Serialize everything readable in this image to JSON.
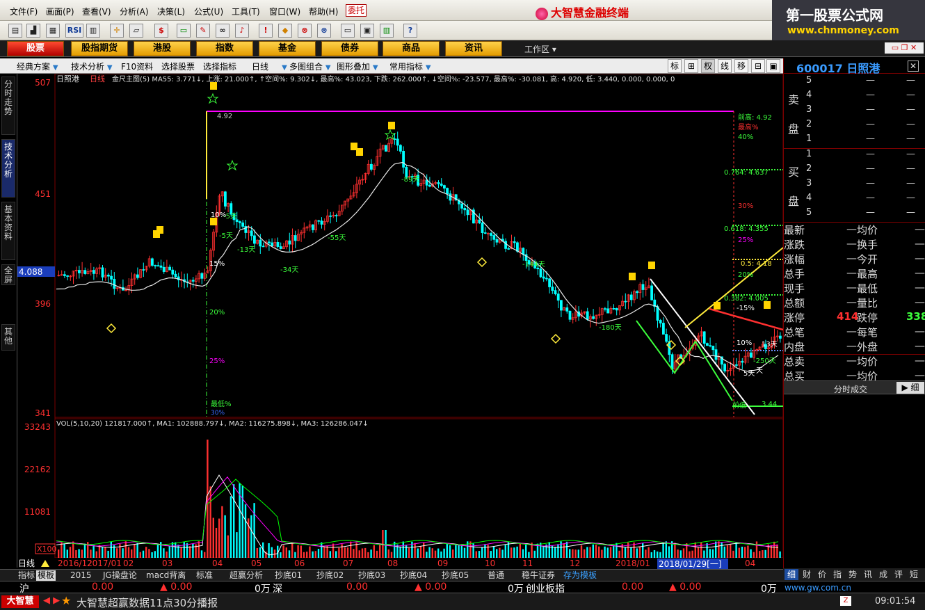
{
  "menu": [
    "文件(F)",
    "画面(P)",
    "查看(V)",
    "分析(A)",
    "决策(L)",
    "公式(U)",
    "工具(T)",
    "窗口(W)",
    "帮助(H)"
  ],
  "menu_entrust": "委托",
  "app_title": "大智慧金融终端",
  "promo": {
    "line1": "第一股票公式网",
    "line2": "www.chnmoney.com"
  },
  "toolbar_icons": [
    "open-icon",
    "chart-icon",
    "grid-icon",
    "rsi-icon",
    "table-icon",
    "crosshair-icon",
    "ruler-icon",
    "dollar-icon",
    "money-icon",
    "pencil-icon",
    "binoculars-icon",
    "bell-icon",
    "news-icon",
    "diamond-icon",
    "link-icon",
    "globe-icon",
    "copy-icon",
    "window-icon",
    "books-icon",
    "help-icon"
  ],
  "toolbar_rsi": "RSI",
  "nav": [
    "股票",
    "股指期货",
    "港股",
    "指数",
    "基金",
    "债券",
    "商品",
    "资讯"
  ],
  "workspace": "工作区",
  "subbar": [
    "经典方案",
    "技术分析",
    "F10资料",
    "选择股票",
    "选择指标",
    "日线",
    "多图组合",
    "图形叠加",
    "常用指标"
  ],
  "subbar_right": [
    "标",
    "⊞",
    "权",
    "线",
    "移",
    "⊟",
    "▣"
  ],
  "left_tabs": [
    "分时走势",
    "技术分析",
    "基本资料",
    "全屏",
    "其他"
  ],
  "stock": {
    "code_name": "600017 日照港"
  },
  "orderbook": {
    "sell_label": [
      "卖",
      "盘"
    ],
    "buy_label": [
      "买",
      "盘"
    ],
    "sell_levels": [
      "5",
      "4",
      "3",
      "2",
      "1"
    ],
    "buy_levels": [
      "1",
      "2",
      "3",
      "4",
      "5"
    ],
    "dash": "—"
  },
  "quote_rows": [
    {
      "k1": "最新",
      "v1": "—",
      "k2": "均价",
      "v2": "—"
    },
    {
      "k1": "涨跌",
      "v1": "—",
      "k2": "换手",
      "v2": "—"
    },
    {
      "k1": "涨幅",
      "v1": "—",
      "k2": "今开",
      "v2": "—"
    },
    {
      "k1": "总手",
      "v1": "—",
      "k2": "最高",
      "v2": "—"
    },
    {
      "k1": "现手",
      "v1": "—",
      "k2": "最低",
      "v2": "—"
    },
    {
      "k1": "总额",
      "v1": "—",
      "k2": "量比",
      "v2": "—"
    },
    {
      "k1": "涨停",
      "v1": "414",
      "k2": "跌停",
      "v2": "338"
    },
    {
      "k1": "总笔",
      "v1": "—",
      "k2": "每笔",
      "v2": "—"
    },
    {
      "k1": "内盘",
      "v1": "—",
      "k2": "外盘",
      "v2": "—"
    },
    {
      "k1": "总卖",
      "v1": "—",
      "k2": "均价",
      "v2": "—"
    },
    {
      "k1": "总买",
      "v1": "—",
      "k2": "均价",
      "v2": "—"
    }
  ],
  "fenshi": {
    "label": "分时成交",
    "fine": "▶ 细"
  },
  "rp_tabs": [
    "细",
    "财",
    "价",
    "指",
    "势",
    "讯",
    "成",
    "评",
    "短"
  ],
  "chart": {
    "header_name": "日照港",
    "header_period": "日线",
    "header_text": "金尺主图(5) MA55: 3.771↓, 上涨: 21.000↑, ↑空间%: 9.302↓, 最高%: 43.023, 下跌: 262.000↑, ↓空间%: -23.577, 最高%: -30.081, 高: 4.920, 低: 3.440, 0.000, 0.000, 0",
    "y_labels": [
      "507",
      "451",
      "396",
      "341"
    ],
    "y_current": "4.088",
    "vol_header": "VOL(5,10,20) 121817.000↑, MA1: 102888.797↓, MA2: 116275.898↓, MA3: 126286.047↓",
    "vol_y_labels": [
      "33243",
      "22162",
      "11081"
    ],
    "vol_unit": "X100",
    "annotations": {
      "high_price": "4.92",
      "qianjao": "前高: 4.92",
      "zuigao": "最高%",
      "pct_40": "40%",
      "fib_764": "0.764: 4.637",
      "pct_30": "30%",
      "fib_618": "0.618: 4.355",
      "pct_25": "25%",
      "fib_5": "0.5: 4.18",
      "pct_20": "20%",
      "fib_382": "0.382: 4.005",
      "pct_neg15": "-15%",
      "pct_10": "10%",
      "day_250": "-250天",
      "day_13": "13天",
      "day_5": "5天",
      "qiandi": "前低",
      "low_price": "3.44",
      "left_15": "15%",
      "left_20": "20%",
      "left_25": "25%",
      "left_zuidi": "最低%",
      "left_30": "30%",
      "left_10": "10%",
      "day_89": "-89天",
      "day_5b": "-5天",
      "day_5c": "-5天",
      "day_55": "-55天",
      "day_13b": "-13天",
      "day_34": "-34天",
      "day_144": "-144天",
      "day_180": "-180天",
      "day_n": "天"
    },
    "dates": [
      "2016/12",
      "2017/01",
      "02",
      "03",
      "04",
      "05",
      "06",
      "07",
      "08",
      "09",
      "10",
      "11",
      "12",
      "2018/01",
      "2018/01/29[一]",
      "04"
    ],
    "period_label": "日线"
  },
  "bottom_tabs": [
    "指标",
    "模板",
    "2015",
    "JG操盘论",
    "macd背离",
    "标准",
    "超赢分析",
    "抄底01",
    "抄底02",
    "抄底03",
    "抄底04",
    "抄底05",
    "普通",
    "稳牛证券",
    "存为模板"
  ],
  "indexbar": {
    "sh": "沪",
    "sh_val": "0.00",
    "sh_chg": "▲ 0.00",
    "sh_pct": "▲ 0.00",
    "sh_amt": "0万",
    "sz": "深",
    "sz_val": "0.00",
    "sz_chg": "▲ 0.00",
    "sz_amt": "0万",
    "cyb": "创业板指",
    "cyb_val": "0.00",
    "cyb_chg": "▲ 0.00",
    "cyb_amt": "0万",
    "site": "www.gw.com.cn"
  },
  "status": {
    "logo": "大智慧",
    "message": "大智慧超赢数据11点30分播报",
    "time": "09:01:54"
  },
  "colors": {
    "up": "#ff3030",
    "down": "#00ffff",
    "ma": "#e8e8e8",
    "vol_ma1": "#ffffff",
    "vol_ma2": "#ff00ff",
    "vol_ma3": "#00ff00",
    "accent_blue": "#3a9bff"
  }
}
